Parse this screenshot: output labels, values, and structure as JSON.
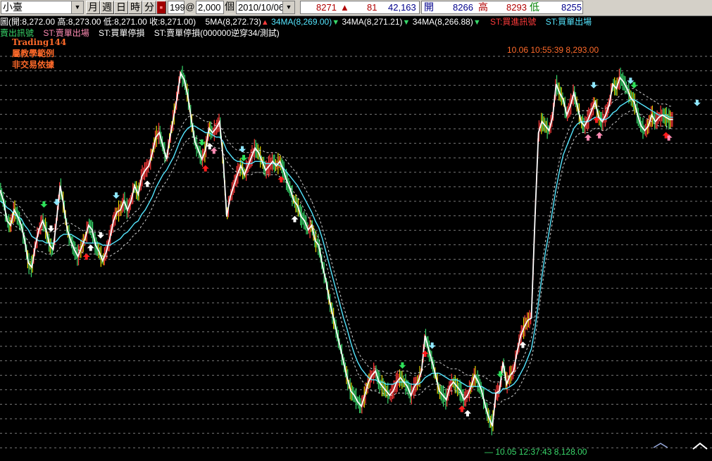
{
  "toolbar": {
    "symbol": "小臺",
    "periods": [
      "月",
      "週",
      "日",
      "時",
      "分"
    ],
    "red_button": "▪",
    "count": "199",
    "at": "@",
    "quantity": "2,000",
    "unit": "個",
    "date": "2010/10/06",
    "quote": {
      "last": "8271",
      "change": "81",
      "volume": "42,163",
      "open_label": "開",
      "open": "8266",
      "high_label": "高",
      "high": "8293",
      "low_label": "低",
      "low": "8255"
    }
  },
  "indicators": {
    "line1": {
      "ohlc": "圖(開:8,272.00 高:8,273.00 低:8,271.00 收:8,271.00)",
      "ma5": "5MA(8,272.73)",
      "ma34a": "34MA(8,269.00)",
      "ma34b": "34MA(8,271.21)",
      "ma34c": "34MA(8,266.88)",
      "buy_signal": "ST:買進訊號",
      "buy_exit": "ST:買單出場"
    },
    "line2": {
      "sell_signal": "賣出訊號",
      "sell_exit": "ST:賣單出場",
      "buy_stop": "ST:買單停損",
      "sell_stop": "ST:賣單停損(000000逆穿34/測試)"
    }
  },
  "note": {
    "line1": "Trading144",
    "line2": "屬教學範例",
    "line3": "非交易依據"
  },
  "chart_data": {
    "type": "line",
    "title": "",
    "ylim": [
      8120,
      8305
    ],
    "grid": true,
    "annotations": {
      "high": "10.06 10:55:39  8,293.00",
      "low": "— 10.05 12:37:43  8,128.00"
    },
    "colors": {
      "background": "#000000",
      "price": "#ffffff",
      "ma_cyan": "#55e6ff",
      "band": "#cfcfcf",
      "bar_up": "#ff3b3b",
      "bar_down": "#38d86a",
      "bar_yellow": "#e8d800"
    },
    "x": [
      0,
      5,
      10,
      15,
      20,
      25,
      30,
      35,
      40,
      45,
      50,
      55,
      60,
      65,
      70,
      75,
      80,
      85,
      90,
      95,
      100,
      105,
      110,
      115,
      120,
      125,
      130,
      135,
      140,
      145,
      150,
      155,
      160,
      165,
      170,
      175,
      180,
      185,
      190,
      195,
      200,
      205,
      210,
      215,
      220,
      225,
      230,
      235,
      240,
      245,
      250,
      255,
      260,
      265,
      270,
      275,
      280,
      285,
      290,
      295,
      300,
      305,
      310,
      315,
      320,
      325,
      330,
      335,
      340,
      345,
      350,
      355,
      360,
      365,
      370,
      375,
      380,
      385,
      390,
      395,
      400,
      405,
      410,
      415,
      420,
      425,
      430,
      435,
      440,
      445,
      450,
      455,
      460,
      465,
      470,
      475,
      480,
      485,
      490,
      495,
      500,
      505,
      510,
      515,
      520,
      525,
      530,
      535,
      540,
      545,
      550,
      555,
      560,
      565,
      570,
      575,
      580,
      585,
      590,
      595,
      600,
      605,
      610,
      615,
      620,
      625,
      630,
      635,
      640,
      645,
      650,
      655,
      660,
      665,
      670,
      675,
      680,
      685,
      690,
      695,
      700,
      705,
      710,
      715,
      720,
      725,
      730,
      735,
      740,
      745,
      750,
      755,
      760,
      765,
      770,
      775,
      780,
      785,
      790,
      795,
      800,
      805,
      810,
      815,
      820,
      825,
      830,
      835,
      840,
      845,
      850,
      855,
      860,
      865,
      870,
      875,
      880,
      885,
      890,
      895,
      900,
      905,
      910,
      915,
      920,
      925,
      930,
      935,
      940,
      945,
      950,
      955,
      960,
      965,
      970,
      975,
      980,
      985,
      990,
      995,
      1000
    ],
    "series": [
      {
        "values": [
          8238,
          8233,
          8224,
          8222,
          8229,
          8226,
          8222,
          8215,
          8205,
          8203,
          8213,
          8220,
          8224,
          8220,
          8213,
          8211,
          8225,
          8240,
          8231,
          8220,
          8215,
          8211,
          8208,
          8212,
          8216,
          8222,
          8220,
          8213,
          8210,
          8206,
          8210,
          8216,
          8224,
          8228,
          8229,
          8233,
          8229,
          8233,
          8240,
          8236,
          8244,
          8247,
          8249,
          8255,
          8262,
          8264,
          8258,
          8252,
          8262,
          8271,
          8280,
          8291,
          8288,
          8281,
          8270,
          8260,
          8256,
          8252,
          8256,
          8266,
          8264,
          8266,
          8269,
          8252,
          8226,
          8235,
          8240,
          8245,
          8249,
          8245,
          8249,
          8253,
          8257,
          8255,
          8251,
          8247,
          8249,
          8251,
          8249,
          8251,
          8247,
          8242,
          8238,
          8233,
          8231,
          8226,
          8224,
          8220,
          8222,
          8215,
          8213,
          8204,
          8197,
          8188,
          8181,
          8174,
          8167,
          8160,
          8153,
          8147,
          8145,
          8142,
          8140,
          8145,
          8151,
          8154,
          8156,
          8151,
          8149,
          8147,
          8145,
          8147,
          8151,
          8153,
          8151,
          8149,
          8145,
          8149,
          8151,
          8156,
          8172,
          8166,
          8160,
          8154,
          8147,
          8145,
          8143,
          8149,
          8151,
          8149,
          8147,
          8143,
          8145,
          8149,
          8154,
          8151,
          8147,
          8140,
          8135,
          8131,
          8146,
          8147,
          8160,
          8150,
          8154,
          8156,
          8165,
          8172,
          8176,
          8179,
          8180,
          8224,
          8264,
          8269,
          8267,
          8265,
          8271,
          8286,
          8282,
          8279,
          8272,
          8276,
          8282,
          8276,
          8269,
          8267,
          8270,
          8274,
          8278,
          8271,
          8269,
          8272,
          8277,
          8286,
          8284,
          8289,
          8287,
          8284,
          8280,
          8278,
          8272,
          8267,
          8265,
          8267,
          8272,
          8269,
          8271,
          8272,
          8271,
          8270,
          8270
        ]
      },
      {
        "values": [
          8233,
          8232,
          8230,
          8229,
          8227,
          8226,
          8225,
          8222,
          8220,
          8217,
          8216,
          8215,
          8215,
          8214,
          8214,
          8214,
          8215,
          8217,
          8218,
          8218,
          8218,
          8217,
          8216,
          8215,
          8214,
          8214,
          8214,
          8214,
          8214,
          8213,
          8213,
          8213,
          8214,
          8215,
          8216,
          8218,
          8219,
          8221,
          8223,
          8224,
          8227,
          8229,
          8232,
          8235,
          8239,
          8242,
          8245,
          8247,
          8250,
          8253,
          8257,
          8261,
          8264,
          8266,
          8267,
          8267,
          8266,
          8265,
          8264,
          8264,
          8263,
          8262,
          8262,
          8260,
          8256,
          8254,
          8252,
          8251,
          8251,
          8250,
          8250,
          8250,
          8251,
          8251,
          8251,
          8250,
          8250,
          8250,
          8250,
          8249,
          8248,
          8246,
          8244,
          8242,
          8240,
          8237,
          8234,
          8231,
          8228,
          8224,
          8221,
          8216,
          8210,
          8204,
          8198,
          8192,
          8186,
          8180,
          8175,
          8169,
          8164,
          8160,
          8157,
          8155,
          8153,
          8152,
          8152,
          8151,
          8151,
          8150,
          8150,
          8150,
          8151,
          8151,
          8151,
          8151,
          8150,
          8150,
          8150,
          8151,
          8153,
          8154,
          8155,
          8155,
          8155,
          8154,
          8153,
          8152,
          8152,
          8152,
          8151,
          8150,
          8149,
          8149,
          8149,
          8149,
          8149,
          8148,
          8147,
          8146,
          8146,
          8146,
          8148,
          8148,
          8149,
          8150,
          8152,
          8155,
          8158,
          8162,
          8166,
          8175,
          8187,
          8199,
          8210,
          8219,
          8229,
          8239,
          8247,
          8254,
          8258,
          8262,
          8266,
          8268,
          8269,
          8269,
          8269,
          8270,
          8271,
          8271,
          8270,
          8270,
          8271,
          8273,
          8274,
          8276,
          8277,
          8278,
          8279,
          8279,
          8278,
          8277,
          8276,
          8275,
          8274,
          8273,
          8272,
          8272,
          8272,
          8271,
          8271
        ]
      }
    ],
    "signals": [
      {
        "x": 62,
        "type": "buy_exit"
      },
      {
        "x": 72,
        "type": "buy_stop"
      },
      {
        "x": 80,
        "type": "sell_exit"
      },
      {
        "x": 128,
        "type": "sell_stop"
      },
      {
        "x": 142,
        "type": "buy_stop"
      },
      {
        "x": 122,
        "type": "buy_signal"
      },
      {
        "x": 164,
        "type": "sell_exit"
      },
      {
        "x": 208,
        "type": "sell_stop"
      },
      {
        "x": 285,
        "type": "buy_exit"
      },
      {
        "x": 296,
        "type": "sell_stop"
      },
      {
        "x": 290,
        "type": "buy_signal"
      },
      {
        "x": 302,
        "type": "sell_signal"
      },
      {
        "x": 344,
        "type": "buy_exit"
      },
      {
        "x": 342,
        "type": "sell_exit"
      },
      {
        "x": 397,
        "type": "buy_signal"
      },
      {
        "x": 416,
        "type": "sell_stop"
      },
      {
        "x": 568,
        "type": "buy_exit"
      },
      {
        "x": 610,
        "type": "sell_exit"
      },
      {
        "x": 600,
        "type": "buy_signal"
      },
      {
        "x": 652,
        "type": "sell_signal"
      },
      {
        "x": 660,
        "type": "sell_stop"
      },
      {
        "x": 652,
        "type": "buy_signal"
      },
      {
        "x": 706,
        "type": "buy_exit"
      },
      {
        "x": 738,
        "type": "sell_stop"
      },
      {
        "x": 830,
        "type": "sell_signal"
      },
      {
        "x": 838,
        "type": "sell_exit"
      },
      {
        "x": 846,
        "type": "sell_signal"
      },
      {
        "x": 842,
        "type": "buy_signal"
      },
      {
        "x": 890,
        "type": "sell_exit"
      },
      {
        "x": 895,
        "type": "buy_exit"
      },
      {
        "x": 944,
        "type": "sell_signal"
      },
      {
        "x": 940,
        "type": "buy_signal"
      },
      {
        "x": 984,
        "type": "sell_exit"
      }
    ]
  }
}
